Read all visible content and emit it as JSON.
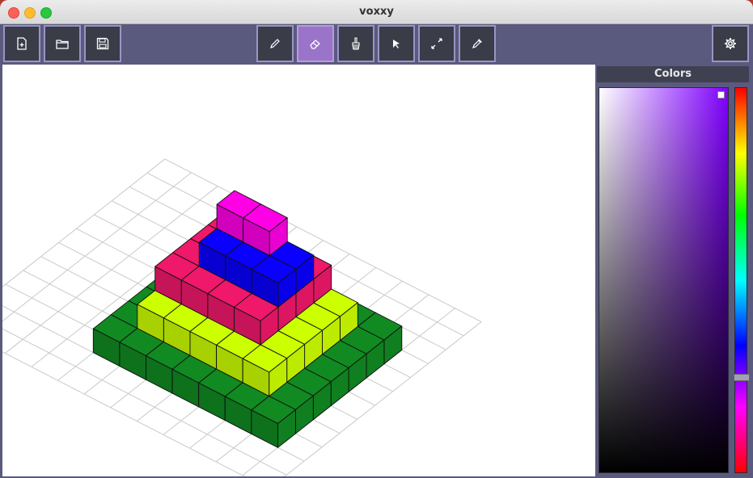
{
  "window": {
    "title": "voxxy"
  },
  "toolbar": {
    "left": [
      {
        "name": "new-file-button",
        "icon": "new-file-icon"
      },
      {
        "name": "open-button",
        "icon": "folder-icon"
      },
      {
        "name": "save-button",
        "icon": "save-icon"
      }
    ],
    "tools": [
      {
        "name": "pencil-tool-button",
        "icon": "pencil-icon",
        "active": false
      },
      {
        "name": "eraser-tool-button",
        "icon": "eraser-icon",
        "active": true
      },
      {
        "name": "brush-tool-button",
        "icon": "brush-icon",
        "active": false
      },
      {
        "name": "select-tool-button",
        "icon": "cursor-icon",
        "active": false
      },
      {
        "name": "resize-tool-button",
        "icon": "resize-icon",
        "active": false
      },
      {
        "name": "eyedropper-tool-button",
        "icon": "eyedropper-icon",
        "active": false
      }
    ],
    "right": [
      {
        "name": "settings-button",
        "icon": "gear-icon"
      }
    ]
  },
  "colors_panel": {
    "header": "Colors",
    "selected_hue": "#8000ff",
    "hue_position": 0.75,
    "saturation": 1.0,
    "value": 1.0
  },
  "scene": {
    "grid": {
      "cells": 12
    },
    "layers": [
      {
        "level": 1,
        "color": "#118a22",
        "label": "green"
      },
      {
        "level": 2,
        "color": "#ccff00",
        "label": "yellow"
      },
      {
        "level": 3,
        "color": "#f0186a",
        "label": "pink"
      },
      {
        "level": 4,
        "color": "#0a00ff",
        "label": "blue"
      },
      {
        "level": 5,
        "color": "#ff00e6",
        "label": "magenta"
      }
    ]
  }
}
